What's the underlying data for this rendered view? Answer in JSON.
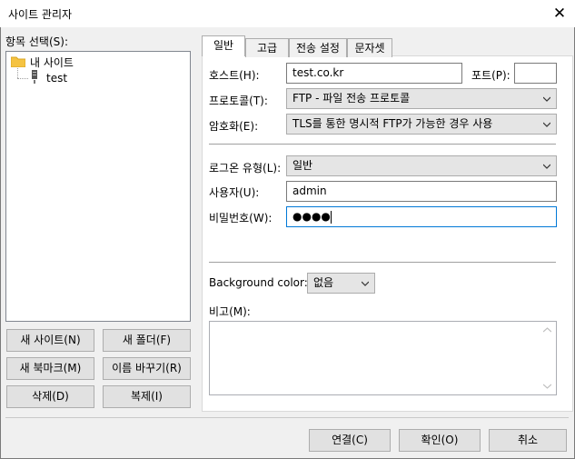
{
  "window": {
    "title": "사이트 관리자"
  },
  "left": {
    "tree_label": "항목 선택(S):",
    "tree": {
      "root": "내 사이트",
      "child": "test"
    },
    "buttons": {
      "new_site": "새 사이트(N)",
      "new_folder": "새 폴더(F)",
      "new_bookmark": "새 북마크(M)",
      "rename": "이름 바꾸기(R)",
      "delete": "삭제(D)",
      "copy": "복제(I)"
    }
  },
  "tabs": [
    "일반",
    "고급",
    "전송 설정",
    "문자셋"
  ],
  "general": {
    "host_label": "호스트(H):",
    "host_value": "test.co.kr",
    "port_label": "포트(P):",
    "port_value": "",
    "protocol_label": "프로토콜(T):",
    "protocol_value": "FTP - 파일 전송 프로토콜",
    "encryption_label": "암호화(E):",
    "encryption_value": "TLS를 통한 명시적 FTP가 가능한 경우 사용",
    "logon_label": "로그온 유형(L):",
    "logon_value": "일반",
    "user_label": "사용자(U):",
    "user_value": "admin",
    "password_label": "비밀번호(W):",
    "password_value": "●●●●",
    "bgcolor_label": "Background color:",
    "bgcolor_value": "없음",
    "notes_label": "비고(M):",
    "notes_value": ""
  },
  "footer": {
    "connect": "연결(C)",
    "ok": "확인(O)",
    "cancel": "취소"
  },
  "icons": [
    "folder-icon",
    "server-icon",
    "close-icon",
    "chevron-down-icon"
  ],
  "colors": {
    "focus_border": "#0078d7",
    "folder": "#f5c342"
  }
}
